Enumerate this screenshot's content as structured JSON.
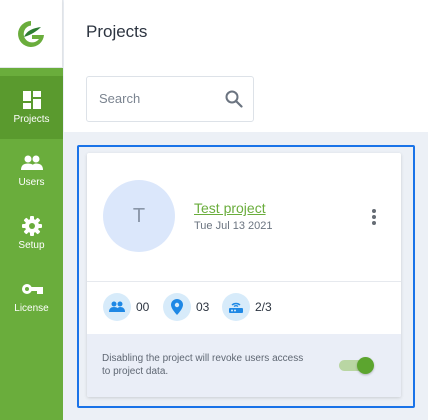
{
  "sidebar": {
    "logo_icon": "g-leaf-logo-icon",
    "items": [
      {
        "label": "Projects",
        "icon": "dashboard-grid-icon",
        "active": true
      },
      {
        "label": "Users",
        "icon": "group-icon",
        "active": false
      },
      {
        "label": "Setup",
        "icon": "gear-icon",
        "active": false
      },
      {
        "label": "License",
        "icon": "key-icon",
        "active": false
      }
    ],
    "colors": {
      "background": "#6aad3c",
      "active": "#5a9a2e"
    }
  },
  "header": {
    "title": "Projects"
  },
  "search": {
    "placeholder": "Search",
    "value": "",
    "icon": "search-icon"
  },
  "project_card": {
    "avatar_letter": "T",
    "name": "Test project",
    "date": "Tue Jul 13 2021",
    "menu_icon": "more-vertical-icon",
    "stats": [
      {
        "icon": "users-icon",
        "value": "00"
      },
      {
        "icon": "location-pin-icon",
        "value": "03"
      },
      {
        "icon": "router-icon",
        "value": "2/3"
      }
    ],
    "footer_text": "Disabling the project will revoke users access to project data.",
    "enabled": true
  },
  "colors": {
    "accent": "#6aad3c",
    "focus": "#1a73e8",
    "stat_icon": "#1e88e5",
    "stat_bubble": "#d7ebfa"
  }
}
